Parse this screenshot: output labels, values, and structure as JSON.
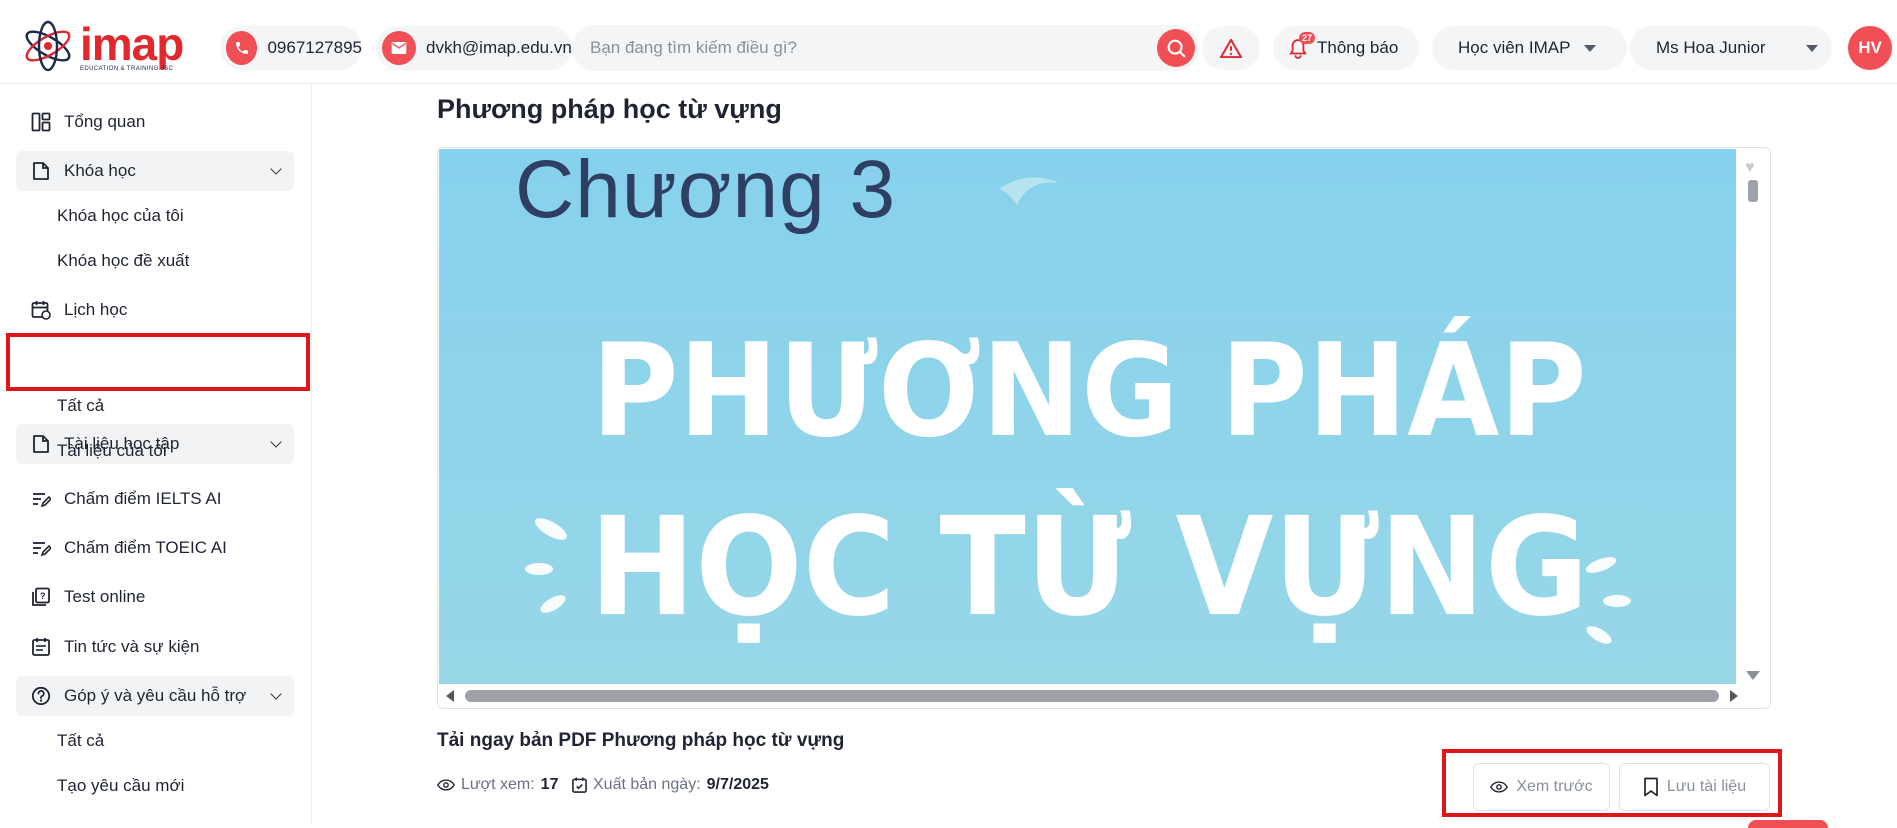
{
  "header": {
    "logo_word": "imap",
    "logo_sub": "EDUCATION & TRAINING JSC",
    "phone": "0967127895",
    "email": "dvkh@imap.edu.vn",
    "search_placeholder": "Bạn đang tìm kiếm điều gì?",
    "notification_count": "27",
    "notification_label": "Thông báo",
    "role_select": "Học viên IMAP",
    "user_select": "Ms Hoa Junior",
    "avatar_initials": "HV"
  },
  "sidebar": {
    "items": [
      {
        "label": "Tổng quan",
        "icon": "dashboard-icon"
      },
      {
        "label": "Khóa học",
        "icon": "book-icon",
        "expanded": true,
        "children": [
          "Khóa học của tôi",
          "Khóa học đề xuất"
        ]
      },
      {
        "label": "Lịch học",
        "icon": "calendar-icon"
      },
      {
        "label": "Tài liệu học tập",
        "icon": "document-icon",
        "expanded": true,
        "children": [
          "Tất cả",
          "Tài liệu của tôi"
        ]
      },
      {
        "label": "Chấm điểm IELTS AI",
        "icon": "grading-icon"
      },
      {
        "label": "Chấm điểm TOEIC AI",
        "icon": "grading-icon"
      },
      {
        "label": "Test online",
        "icon": "quiz-icon"
      },
      {
        "label": "Tin tức và sự kiện",
        "icon": "news-icon"
      },
      {
        "label": "Góp ý và yêu cầu hỗ trợ",
        "icon": "help-icon",
        "expanded": true,
        "children": [
          "Tất cả",
          "Tạo yêu cầu mới"
        ]
      }
    ]
  },
  "main": {
    "page_title": "Phương pháp học từ vựng",
    "slide": {
      "chapter": "Chương 3",
      "line1": "PHƯƠNG PHÁP",
      "line2": "HỌC TỪ VỰNG"
    },
    "doc_title": "Tải ngay bản PDF Phương pháp học từ vựng",
    "views_label": "Lượt xem:",
    "views_value": "17",
    "published_label": "Xuất bản ngày:",
    "published_value": "9/7/2025",
    "preview_button": "Xem trước",
    "save_button": "Lưu tài liệu"
  },
  "colors": {
    "brand_red": "#ef4f55",
    "highlight_red": "#e0151b",
    "slide_bg": "#8fd3eb",
    "slide_dark_text": "#2e3f63"
  }
}
